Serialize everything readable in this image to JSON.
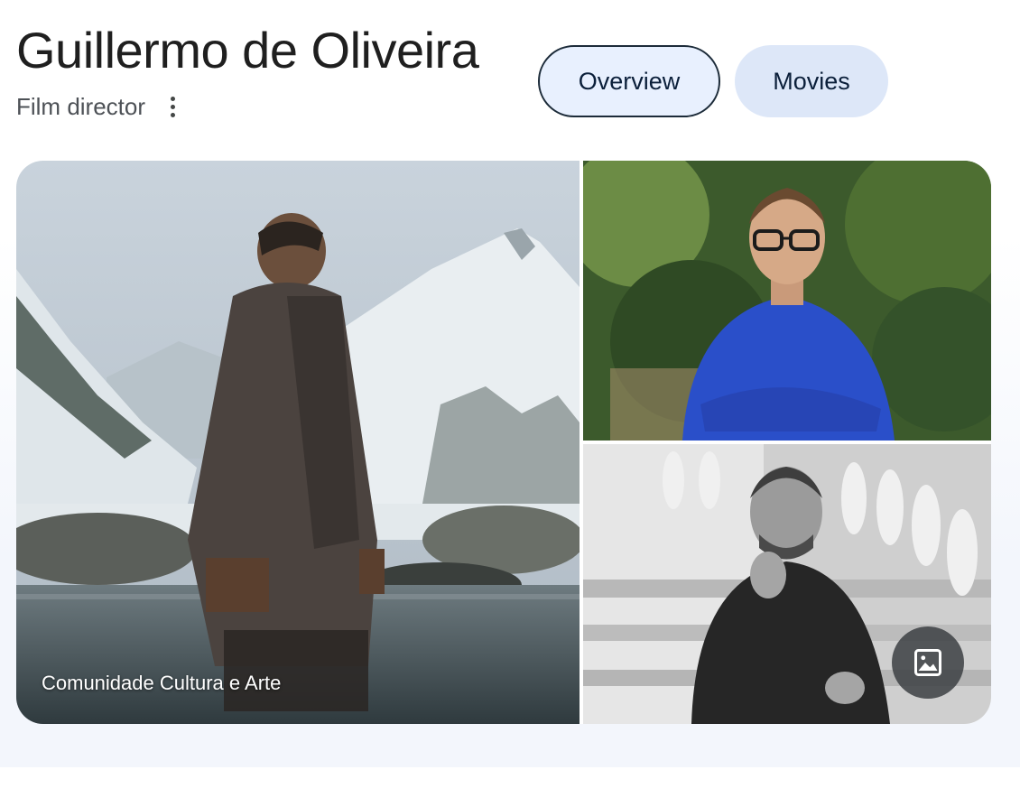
{
  "header": {
    "title": "Guillermo de Oliveira",
    "subtitle": "Film director",
    "more_icon": "more-vert-icon"
  },
  "tabs": [
    {
      "label": "Overview",
      "selected": true
    },
    {
      "label": "Movies",
      "selected": false
    }
  ],
  "gallery": {
    "main_caption": "Comunidade Cultura e Arte",
    "images_button_icon": "image-icon"
  },
  "colors": {
    "tab_bg": "#e8f0fe",
    "tab_border": "#1c2b39",
    "panel_bg": "#f3f6fc"
  }
}
